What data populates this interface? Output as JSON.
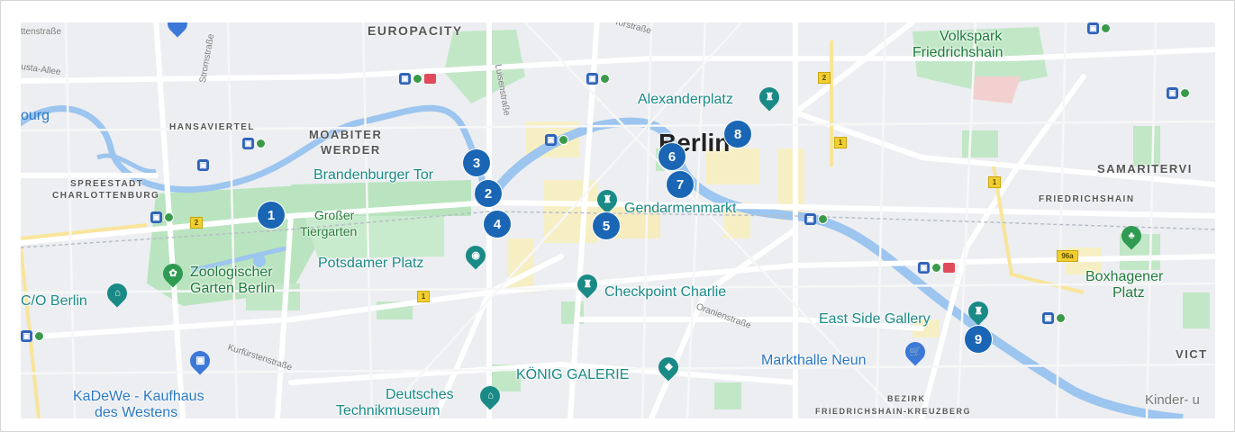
{
  "map": {
    "city_label": "Berlin",
    "accent_color": "#1a66b5",
    "markers": [
      {
        "n": "1"
      },
      {
        "n": "2"
      },
      {
        "n": "3"
      },
      {
        "n": "4"
      },
      {
        "n": "5"
      },
      {
        "n": "6"
      },
      {
        "n": "7"
      },
      {
        "n": "8"
      },
      {
        "n": "9"
      }
    ],
    "poi_labels": {
      "alexanderplatz": "Alexanderplatz",
      "brandenburger_tor": "Brandenburger Tor",
      "gendarmenmarkt": "Gendarmenmarkt",
      "potsdamer_platz": "Potsdamer Platz",
      "checkpoint_charlie": "Checkpoint Charlie",
      "east_side_gallery": "East Side Gallery",
      "markthalle_neun": "Markthalle Neun",
      "konig_galerie": "KÖNIG GALERIE",
      "deutsches_technikmuseum_1": "Deutsches",
      "deutsches_technikmuseum_2": "Technikmuseum",
      "co_berlin": "C/O Berlin",
      "kadewe_1": "KaDeWe - Kaufhaus",
      "kadewe_2": "des Westens",
      "zoo_1": "Zoologischer",
      "zoo_2": "Garten Berlin",
      "boxhagener_1": "Boxhagener",
      "boxhagener_2": "Platz",
      "volkspark_1": "Volkspark",
      "volkspark_2": "Friedrichshain",
      "kinder": "Kinder- u"
    },
    "park_labels": {
      "tiergarten_1": "Großer",
      "tiergarten_2": "Tiergarten"
    },
    "districts": {
      "europacity": "EUROPACITY",
      "moabiter_1": "MOABITER",
      "moabiter_2": "WERDER",
      "hansaviertel": "HANSAVIERTEL",
      "spreestadt_1": "SPREESTADT",
      "spreestadt_2": "CHARLOTTENBURG",
      "samariterviertel": "SAMARITERVI",
      "friedrichshain": "FRIEDRICHSHAIN",
      "vict": "VICT",
      "bezirk_1": "BEZIRK",
      "bezirk_2": "FRIEDRICHSHAIN-KREUZBERG"
    },
    "streets": {
      "s1": "ttenstraße",
      "s2": "usta-Allee",
      "s3": "ourg",
      "s4": "Stromstraße",
      "s5": "Luisenstraße",
      "s6": "Oranienstraße",
      "s7": "Kurfürstenstraße",
      "s8": "Torstraße"
    },
    "road_shields": [
      "2",
      "2",
      "1",
      "1",
      "1",
      "96a"
    ]
  }
}
